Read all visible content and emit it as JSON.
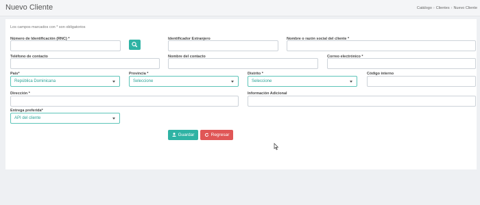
{
  "header": {
    "title": "Nuevo Cliente",
    "breadcrumb": [
      "Catálogo",
      "Clientes",
      "Nuevo Cliente"
    ]
  },
  "form": {
    "note": "Los campos marcados con * son obligatorios",
    "fields": {
      "rnc": {
        "label": "Número de Identificación (RNC) *",
        "value": ""
      },
      "extranjero": {
        "label": "Identificador Extranjero",
        "value": ""
      },
      "nombre": {
        "label": "Nombre o razón social del cliente *",
        "value": ""
      },
      "telefono": {
        "label": "Teléfono de contacto",
        "value": ""
      },
      "contacto": {
        "label": "Nombre del contacto",
        "value": ""
      },
      "correo": {
        "label": "Correo electrónico *",
        "value": ""
      },
      "pais": {
        "label": "País*",
        "selected": "República Dominicana"
      },
      "provincia": {
        "label": "Provincia *",
        "selected": "Seleccione"
      },
      "distrito": {
        "label": "Distrito *",
        "selected": "Seleccione"
      },
      "codigo": {
        "label": "Código interno",
        "value": ""
      },
      "direccion": {
        "label": "Dirección *",
        "value": ""
      },
      "info": {
        "label": "Información Adicional",
        "value": ""
      },
      "entrega": {
        "label": "Entrega preferida*",
        "selected": "API del cliente"
      }
    },
    "buttons": {
      "save": "Guardar",
      "back": "Regresar"
    }
  },
  "colors": {
    "accent": "#2fb3a4",
    "danger": "#e05656"
  },
  "icons": {
    "search": "search-icon",
    "save": "user-icon",
    "back": "refresh-icon"
  }
}
